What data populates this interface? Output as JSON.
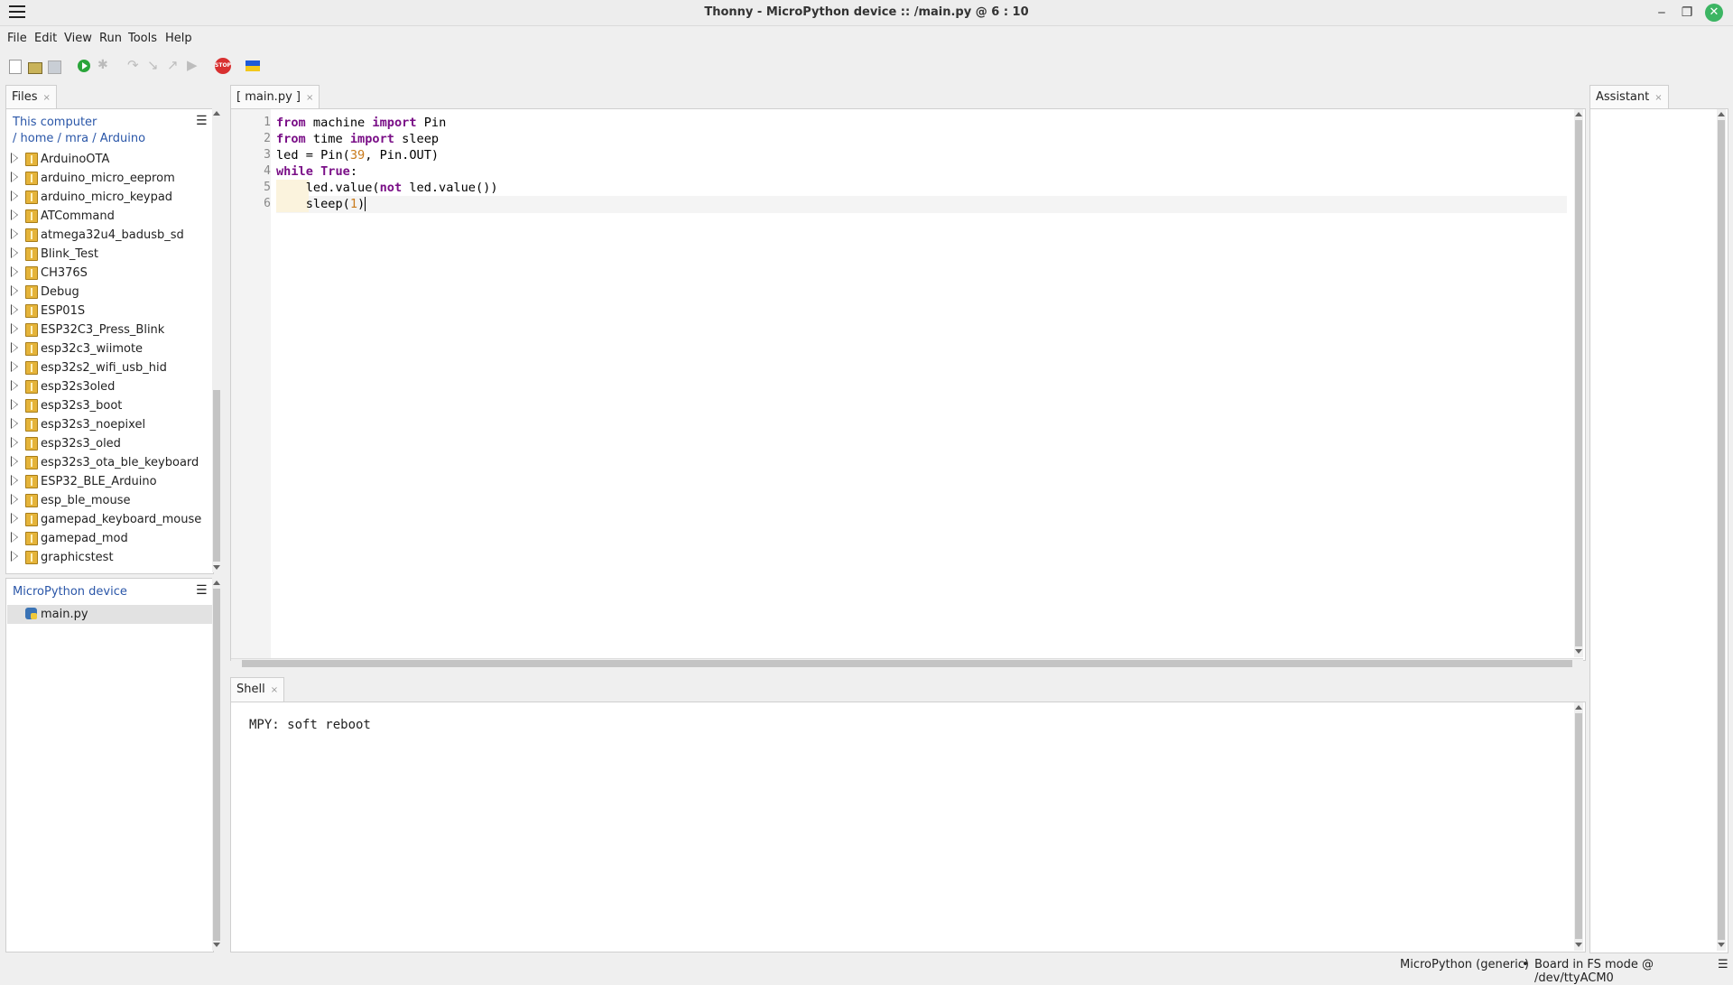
{
  "window": {
    "title": "Thonny  -  MicroPython device :: /main.py  @  6 : 10",
    "minimize_glyph": "‒",
    "maximize_glyph": "❐",
    "close_glyph": "✕"
  },
  "menu": [
    "File",
    "Edit",
    "View",
    "Run",
    "Tools",
    "Help"
  ],
  "toolbar": {
    "icons": [
      "new-file",
      "open-file",
      "save-file",
      "run",
      "debug",
      "step-over",
      "step-into",
      "step-out",
      "resume",
      "stop",
      "ukraine-flag"
    ],
    "stop_label": "STOP"
  },
  "files_panel": {
    "tab_label": "Files",
    "local_header": "This computer",
    "path": [
      "/",
      "home",
      "/",
      "mra",
      "/",
      "Arduino"
    ],
    "folders": [
      "ArduinoOTA",
      "arduino_micro_eeprom",
      "arduino_micro_keypad",
      "ATCommand",
      "atmega32u4_badusb_sd",
      "Blink_Test",
      "CH376S",
      "Debug",
      "ESP01S",
      "ESP32C3_Press_Blink",
      "esp32c3_wiimote",
      "esp32s2_wifi_usb_hid",
      "esp32s3oled",
      "esp32s3_boot",
      "esp32s3_noepixel",
      "esp32s3_oled",
      "esp32s3_ota_ble_keyboard",
      "ESP32_BLE_Arduino",
      "esp_ble_mouse",
      "gamepad_keyboard_mouse",
      "gamepad_mod",
      "graphicstest"
    ],
    "device_header": "MicroPython device",
    "device_files": [
      "main.py"
    ]
  },
  "editor": {
    "tab_label": "[ main.py ]",
    "line_numbers": [
      "1",
      "2",
      "3",
      "4",
      "5",
      "6"
    ],
    "lines": [
      [
        {
          "t": "from",
          "c": "kw"
        },
        {
          "t": " machine "
        },
        {
          "t": "import",
          "c": "kw"
        },
        {
          "t": " Pin"
        }
      ],
      [
        {
          "t": "from",
          "c": "kw"
        },
        {
          "t": " time "
        },
        {
          "t": "import",
          "c": "kw"
        },
        {
          "t": " sleep"
        }
      ],
      [
        {
          "t": "led = Pin("
        },
        {
          "t": "39",
          "c": "num"
        },
        {
          "t": ", Pin.OUT)"
        }
      ],
      [
        {
          "t": "while",
          "c": "kw"
        },
        {
          "t": " "
        },
        {
          "t": "True",
          "c": "kw"
        },
        {
          "t": ":"
        }
      ],
      [
        {
          "t": "    led.value("
        },
        {
          "t": "not",
          "c": "kw"
        },
        {
          "t": " led.value())"
        }
      ],
      [
        {
          "t": "    sleep("
        },
        {
          "t": "1",
          "c": "num"
        },
        {
          "t": ")"
        }
      ]
    ]
  },
  "shell": {
    "tab_label": "Shell",
    "output": "MPY: soft reboot"
  },
  "assistant": {
    "tab_label": "Assistant"
  },
  "status_bar": {
    "interpreter": "MicroPython (generic)",
    "separator": "•",
    "board": "Board in FS mode @ /dev/ttyACM0"
  },
  "tab_close_glyph": "×"
}
